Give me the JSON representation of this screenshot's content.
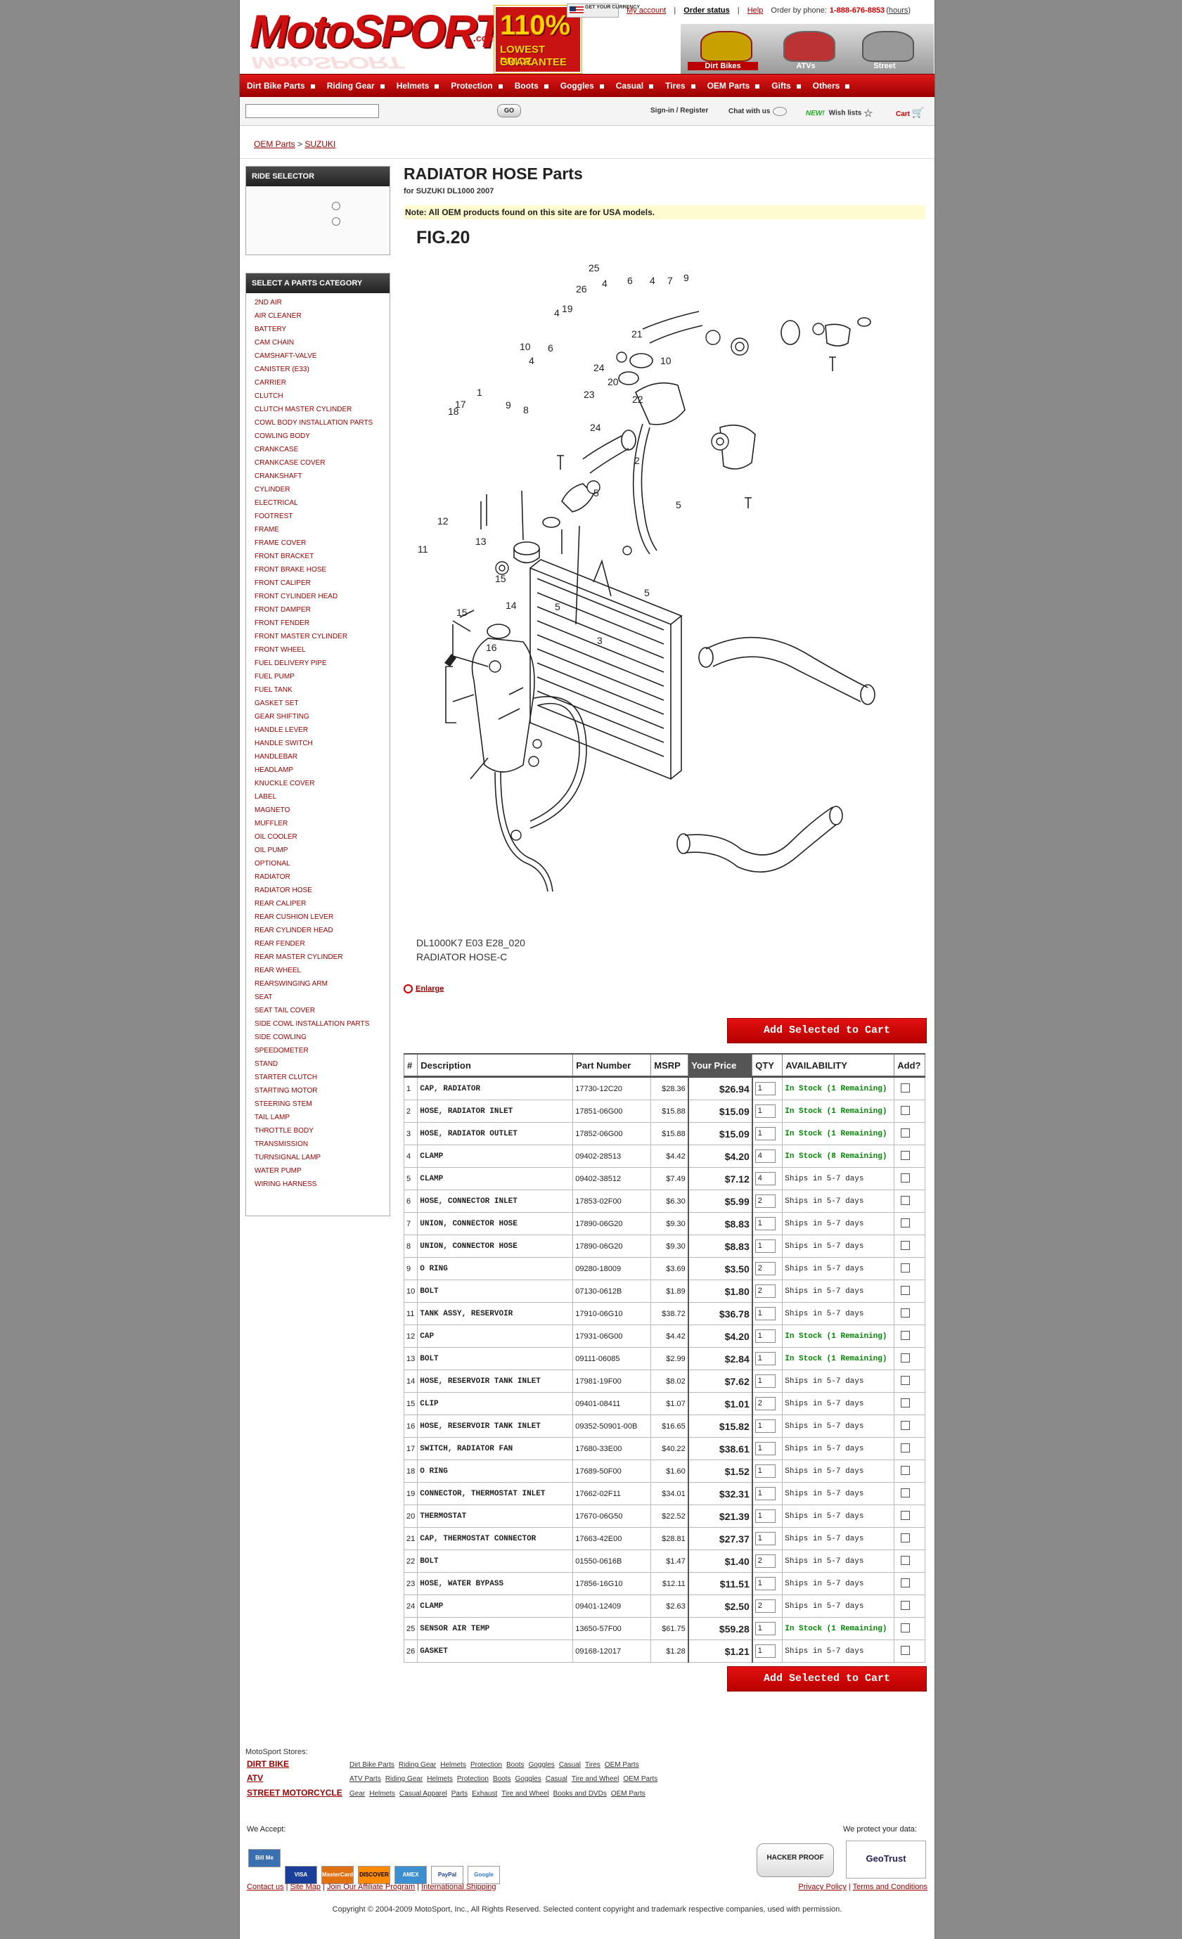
{
  "header": {
    "logo_text": "MotoSPORT",
    "logo_suffix": ".com",
    "guarantee_pct": "110%",
    "guarantee_l1": "LOWEST PRICE",
    "guarantee_l2": "GUARANTEE",
    "flag_label": "GET YOUR CURRENCY",
    "my_account": "My account",
    "order_status": "Order status",
    "help": "Help",
    "order_by_phone": "Order by phone:",
    "phone": "1-888-676-8853",
    "hours": "hours",
    "vehicles": [
      "Dirt Bikes",
      "ATVs",
      "Street"
    ]
  },
  "nav": [
    "Dirt Bike Parts",
    "Riding Gear",
    "Helmets",
    "Protection",
    "Boots",
    "Goggles",
    "Casual",
    "Tires",
    "OEM Parts",
    "Gifts",
    "Others"
  ],
  "search": {
    "go": "GO",
    "signin": "Sign-in / Register",
    "chat": "Chat with us",
    "new": "NEW!",
    "wish": "Wish lists",
    "cart": "Cart"
  },
  "breadcrumb": {
    "oem": "OEM Parts",
    "sep": ">",
    "make": "SUZUKI"
  },
  "sidebar": {
    "ride_title": "RIDE SELECTOR",
    "cat_title": "SELECT A PARTS CATEGORY",
    "categories": [
      "2ND AIR",
      "AIR CLEANER",
      "BATTERY",
      "CAM CHAIN",
      "CAMSHAFT-VALVE",
      "CANISTER (E33)",
      "CARRIER",
      "CLUTCH",
      "CLUTCH MASTER CYLINDER",
      "COWL BODY INSTALLATION PARTS",
      "COWLING BODY",
      "CRANKCASE",
      "CRANKCASE COVER",
      "CRANKSHAFT",
      "CYLINDER",
      "ELECTRICAL",
      "FOOTREST",
      "FRAME",
      "FRAME COVER",
      "FRONT BRACKET",
      "FRONT BRAKE HOSE",
      "FRONT CALIPER",
      "FRONT CYLINDER HEAD",
      "FRONT DAMPER",
      "FRONT FENDER",
      "FRONT MASTER CYLINDER",
      "FRONT WHEEL",
      "FUEL DELIVERY PIPE",
      "FUEL PUMP",
      "FUEL TANK",
      "GASKET SET",
      "GEAR SHIFTING",
      "HANDLE LEVER",
      "HANDLE SWITCH",
      "HANDLEBAR",
      "HEADLAMP",
      "KNUCKLE COVER",
      "LABEL",
      "MAGNETO",
      "MUFFLER",
      "OIL COOLER",
      "OIL PUMP",
      "OPTIONAL",
      "RADIATOR",
      "RADIATOR HOSE",
      "REAR CALIPER",
      "REAR CUSHION LEVER",
      "REAR CYLINDER HEAD",
      "REAR FENDER",
      "REAR MASTER CYLINDER",
      "REAR WHEEL",
      "REARSWINGING ARM",
      "SEAT",
      "SEAT TAIL COVER",
      "SIDE COWL INSTALLATION PARTS",
      "SIDE COWLING",
      "SPEEDOMETER",
      "STAND",
      "STARTER CLUTCH",
      "STARTING MOTOR",
      "STEERING STEM",
      "TAIL LAMP",
      "THROTTLE BODY",
      "TRANSMISSION",
      "TURNSIGNAL LAMP",
      "WATER PUMP",
      "WIRING HARNESS"
    ]
  },
  "main": {
    "title": "RADIATOR HOSE Parts",
    "subtitle": "for SUZUKI DL1000 2007",
    "note": "Note: All OEM products found on this site are for USA models.",
    "fig": "FIG.20",
    "diagram_code": "DL1000K7 E03 E28_020",
    "diagram_name": "RADIATOR HOSE-C",
    "enlarge": "Enlarge",
    "add_to_cart": "Add Selected to Cart"
  },
  "table": {
    "headers": [
      "#",
      "Description",
      "Part Number",
      "MSRP",
      "Your Price",
      "QTY",
      "AVAILABILITY",
      "Add?"
    ],
    "rows": [
      [
        "1",
        "CAP, RADIATOR",
        "17730-12C20",
        "$28.36",
        "$26.94",
        "1",
        "In Stock (1 Remaining)"
      ],
      [
        "2",
        "HOSE, RADIATOR INLET",
        "17851-06G00",
        "$15.88",
        "$15.09",
        "1",
        "In Stock (1 Remaining)"
      ],
      [
        "3",
        "HOSE, RADIATOR OUTLET",
        "17852-06G00",
        "$15.88",
        "$15.09",
        "1",
        "In Stock (1 Remaining)"
      ],
      [
        "4",
        "CLAMP",
        "09402-28513",
        "$4.42",
        "$4.20",
        "4",
        "In Stock (8 Remaining)"
      ],
      [
        "5",
        "CLAMP",
        "09402-38512",
        "$7.49",
        "$7.12",
        "4",
        "Ships in 5-7 days"
      ],
      [
        "6",
        "HOSE, CONNECTOR INLET",
        "17853-02F00",
        "$6.30",
        "$5.99",
        "2",
        "Ships in 5-7 days"
      ],
      [
        "7",
        "UNION, CONNECTOR HOSE",
        "17890-06G20",
        "$9.30",
        "$8.83",
        "1",
        "Ships in 5-7 days"
      ],
      [
        "8",
        "UNION, CONNECTOR HOSE",
        "17890-06G20",
        "$9.30",
        "$8.83",
        "1",
        "Ships in 5-7 days"
      ],
      [
        "9",
        "O RING",
        "09280-18009",
        "$3.69",
        "$3.50",
        "2",
        "Ships in 5-7 days"
      ],
      [
        "10",
        "BOLT",
        "07130-0612B",
        "$1.89",
        "$1.80",
        "2",
        "Ships in 5-7 days"
      ],
      [
        "11",
        "TANK ASSY, RESERVOIR",
        "17910-06G10",
        "$38.72",
        "$36.78",
        "1",
        "Ships in 5-7 days"
      ],
      [
        "12",
        "CAP",
        "17931-06G00",
        "$4.42",
        "$4.20",
        "1",
        "In Stock (1 Remaining)"
      ],
      [
        "13",
        "BOLT",
        "09111-06085",
        "$2.99",
        "$2.84",
        "1",
        "In Stock (1 Remaining)"
      ],
      [
        "14",
        "HOSE, RESERVOIR TANK INLET",
        "17981-19F00",
        "$8.02",
        "$7.62",
        "1",
        "Ships in 5-7 days"
      ],
      [
        "15",
        "CLIP",
        "09401-08411",
        "$1.07",
        "$1.01",
        "2",
        "Ships in 5-7 days"
      ],
      [
        "16",
        "HOSE, RESERVOIR TANK INLET",
        "09352-50901-00B",
        "$16.65",
        "$15.82",
        "1",
        "Ships in 5-7 days"
      ],
      [
        "17",
        "SWITCH, RADIATOR FAN",
        "17680-33E00",
        "$40.22",
        "$38.61",
        "1",
        "Ships in 5-7 days"
      ],
      [
        "18",
        "O RING",
        "17689-50F00",
        "$1.60",
        "$1.52",
        "1",
        "Ships in 5-7 days"
      ],
      [
        "19",
        "CONNECTOR, THERMOSTAT INLET",
        "17662-02F11",
        "$34.01",
        "$32.31",
        "1",
        "Ships in 5-7 days"
      ],
      [
        "20",
        "THERMOSTAT",
        "17670-06G50",
        "$22.52",
        "$21.39",
        "1",
        "Ships in 5-7 days"
      ],
      [
        "21",
        "CAP, THERMOSTAT CONNECTOR",
        "17663-42E00",
        "$28.81",
        "$27.37",
        "1",
        "Ships in 5-7 days"
      ],
      [
        "22",
        "BOLT",
        "01550-0616B",
        "$1.47",
        "$1.40",
        "2",
        "Ships in 5-7 days"
      ],
      [
        "23",
        "HOSE, WATER BYPASS",
        "17856-16G10",
        "$12.11",
        "$11.51",
        "1",
        "Ships in 5-7 days"
      ],
      [
        "24",
        "CLAMP",
        "09401-12409",
        "$2.63",
        "$2.50",
        "2",
        "Ships in 5-7 days"
      ],
      [
        "25",
        "SENSOR AIR TEMP",
        "13650-57F00",
        "$61.75",
        "$59.28",
        "1",
        "In Stock (1 Remaining)"
      ],
      [
        "26",
        "GASKET",
        "09168-12017",
        "$1.28",
        "$1.21",
        "1",
        "Ships in 5-7 days"
      ]
    ]
  },
  "footer": {
    "stores_label": "MotoSport Stores:",
    "stores": [
      {
        "name": "DIRT BIKE",
        "links": [
          "Dirt Bike Parts",
          "Riding Gear",
          "Helmets",
          "Protection",
          "Boots",
          "Goggles",
          "Casual",
          "Tires",
          "OEM Parts"
        ]
      },
      {
        "name": "ATV",
        "links": [
          "ATV Parts",
          "Riding Gear",
          "Helmets",
          "Protection",
          "Boots",
          "Goggles",
          "Casual",
          "Tire and Wheel",
          "OEM Parts"
        ]
      },
      {
        "name": "STREET MOTORCYCLE",
        "links": [
          "Gear",
          "Helmets",
          "Casual Apparel",
          "Parts",
          "Exhaust",
          "Tire and Wheel",
          "Books and DVDs",
          "OEM Parts"
        ]
      }
    ],
    "we_accept": "We Accept:",
    "cards": [
      "Bill Me Later",
      "VISA",
      "MasterCard",
      "DISCOVER",
      "AMEX",
      "PayPal",
      "Google"
    ],
    "we_protect": "We protect your data:",
    "hacker": "HACKER PROOF",
    "geotrust": "GeoTrust",
    "left_links": [
      "Contact us",
      "Site Map",
      "Join Our Affiliate Program",
      "International Shipping"
    ],
    "right_links": [
      "Privacy Policy",
      "Terms and Conditions"
    ],
    "copyright": "Copyright © 2004-2009 MotoSport, Inc., All Rights Reserved. Selected content copyright and trademark respective companies, used with permission."
  },
  "colors": {
    "brand_red": "#d01010",
    "in_stock": "#008800",
    "link": "#990000"
  }
}
